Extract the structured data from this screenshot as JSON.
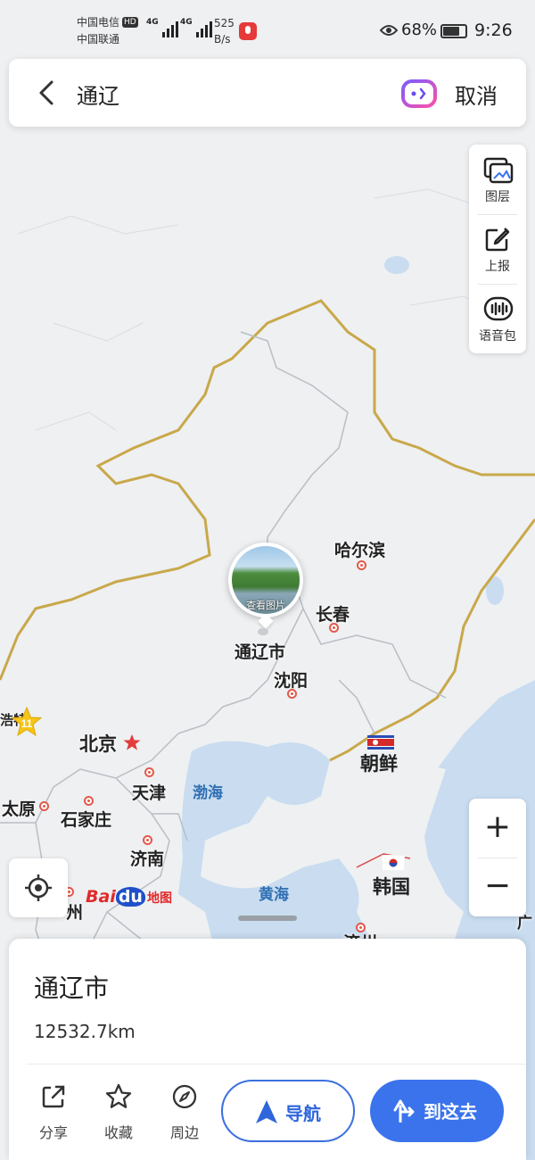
{
  "status_bar": {
    "carrier1": "中国电信",
    "carrier2": "中国联通",
    "hd": "HD",
    "network1": "4G",
    "network2": "4G",
    "speed_value": "525",
    "speed_unit": "B/s",
    "battery": "68%",
    "time": "9:26"
  },
  "search": {
    "query": "通辽",
    "cancel_label": "取消"
  },
  "tools": {
    "layers": "图层",
    "report": "上报",
    "voice_pack": "语音包"
  },
  "map": {
    "pin_caption": "查看图片",
    "cities": {
      "tongliao": "通辽市",
      "harbin": "哈尔滨",
      "changchun": "长春",
      "shenyang": "沈阳",
      "beijing": "北京",
      "tianjin": "天津",
      "shijiazhuang": "石家庄",
      "taiyuan": "太原",
      "jinan": "济南",
      "zhengzhou_partial": "州",
      "jeju_partial": "济州",
      "guangzhou_partial": "广",
      "hohhot_partial": "浩特"
    },
    "seas": {
      "bohai": "渤海",
      "yellow_sea": "黄海"
    },
    "countries": {
      "north_korea": "朝鲜",
      "south_korea": "韩国"
    },
    "highway_number": "11",
    "logo": {
      "bai": "Bai",
      "du": "du",
      "ditu": "地图"
    }
  },
  "zoom": {
    "in": "+",
    "out": "−"
  },
  "card": {
    "place_name": "通辽市",
    "distance": "12532.7km",
    "share": "分享",
    "favorite": "收藏",
    "nearby": "周边",
    "navigate": "导航",
    "go_here": "到这去"
  },
  "colors": {
    "primary_blue": "#3a73ec",
    "border_gold": "#c9a84a",
    "sea_blue": "#c9dcf0",
    "city_dot_red": "#e25a4b"
  }
}
